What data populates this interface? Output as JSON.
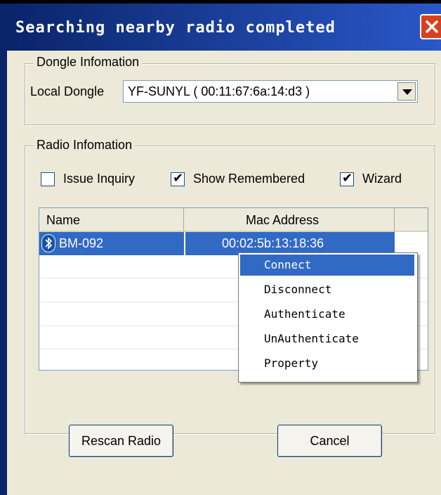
{
  "window": {
    "title": "Searching nearby radio completed",
    "close_icon": "close-icon"
  },
  "dongle_group": {
    "legend": "Dongle Infomation",
    "local_dongle_label": "Local Dongle",
    "local_dongle_value": "YF-SUNYL ( 00:11:67:6a:14:d3 )"
  },
  "radio_group": {
    "legend": "Radio Infomation",
    "checkboxes": [
      {
        "label": "Issue Inquiry",
        "checked": false
      },
      {
        "label": "Show Remembered",
        "checked": true
      },
      {
        "label": "Wizard",
        "checked": true
      }
    ],
    "list": {
      "columns": [
        "Name",
        "Mac Address"
      ],
      "rows": [
        {
          "name": "BM-092",
          "mac": "00:02:5b:13:18:36",
          "selected": true,
          "icon": "bluetooth-icon"
        }
      ]
    }
  },
  "context_menu": {
    "items": [
      "Connect",
      "Disconnect",
      "Authenticate",
      "UnAuthenticate",
      "Property"
    ],
    "highlighted_index": 0
  },
  "buttons": {
    "rescan": "Rescan Radio",
    "cancel": "Cancel"
  }
}
